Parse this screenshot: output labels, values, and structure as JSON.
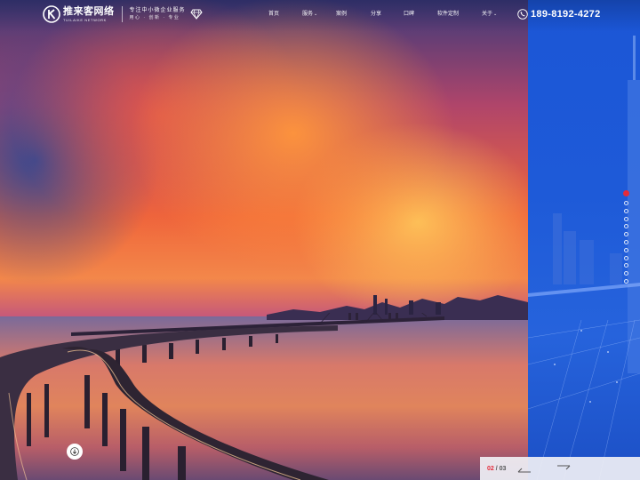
{
  "brand": {
    "name": "推来客网络",
    "subtitle": "TUILAIKE NETWORK",
    "tagline_main": "专注中小微企业服务",
    "tagline_sub": "用心 · 创新 · 专业"
  },
  "nav": {
    "items": [
      {
        "label": "首页"
      },
      {
        "label": "服务"
      },
      {
        "label": "案例"
      },
      {
        "label": "分享"
      },
      {
        "label": "口碑"
      },
      {
        "label": "软件定制"
      },
      {
        "label": "关于"
      }
    ]
  },
  "contact": {
    "phone": "189-8192-4272"
  },
  "slider": {
    "current": "02",
    "separator": "/",
    "total": "03",
    "dot_count": 12,
    "active_dot": 0
  },
  "colors": {
    "accent_red": "#e52b3a",
    "panel_blue": "#1e5ad8"
  },
  "icons": {
    "scroll": "arrow-down-icon",
    "phone": "phone-icon",
    "prev": "arrow-left-icon",
    "next": "arrow-right-icon"
  }
}
